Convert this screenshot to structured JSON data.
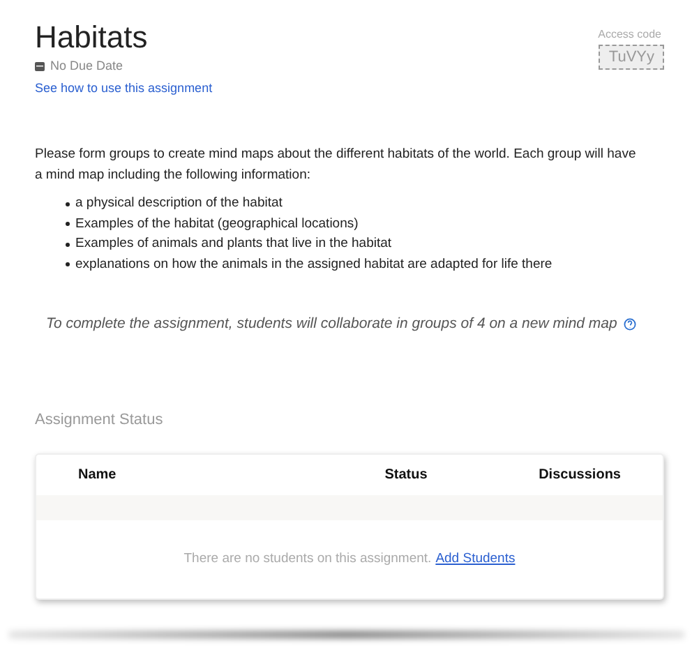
{
  "title": "Habitats",
  "due_date": "No Due Date",
  "help_link": "See how to use this assignment",
  "access_code": {
    "label": "Access code",
    "code": "TuVYy"
  },
  "description": "Please form groups to create mind maps about the different habitats of the world. Each group will have a mind map including the following information:",
  "bullets": [
    "a physical description of the habitat",
    "Examples of the habitat (geographical locations)",
    "Examples of animals and plants that live in the habitat",
    "explanations on how the animals in the assigned habitat are adapted for life there"
  ],
  "collaboration_note": "To complete the assignment, students will collaborate in groups of 4 on a new mind map",
  "status_section": {
    "heading": "Assignment Status",
    "columns": [
      "Name",
      "Status",
      "Discussions"
    ],
    "empty_message": "There are no students on this assignment.",
    "empty_link": "Add Students"
  }
}
